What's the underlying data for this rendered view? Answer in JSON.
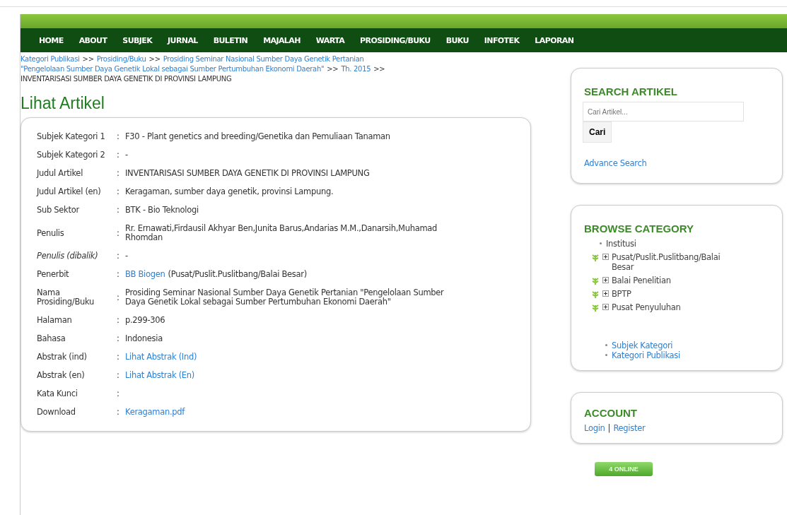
{
  "nav": [
    "HOME",
    "ABOUT",
    "SUBJEK",
    "JURNAL",
    "BULETIN",
    "MAJALAH",
    "WARTA",
    "PROSIDING/BUKU",
    "BUKU",
    "INFOTEK",
    "LAPORAN"
  ],
  "breadcrumb": [
    [
      {
        "kind": "link",
        "text": "Kategori Publikasi"
      },
      {
        "kind": "sep",
        "text": ">>"
      },
      {
        "kind": "link",
        "text": "Prosiding/Buku"
      },
      {
        "kind": "sep",
        "text": ">>"
      },
      {
        "kind": "link",
        "text": "Prosiding Seminar Nasional Sumber Daya Genetik Pertanian"
      }
    ],
    [
      {
        "kind": "link",
        "text": "\"Pengelolaan Sumber Daya Genetik Lokal sebagai Sumber Pertumbuhan Ekonomi Daerah\""
      },
      {
        "kind": "sep",
        "text": ">>"
      },
      {
        "kind": "link",
        "text": "Th. 2015"
      },
      {
        "kind": "sep",
        "text": ">>"
      }
    ],
    [
      {
        "kind": "text",
        "text": "INVENTARISASI SUMBER DAYA GENETIK DI PROVINSI LAMPUNG"
      }
    ]
  ],
  "page_title": "Lihat Artikel",
  "fields": [
    {
      "label": "Subjek Kategori 1",
      "italic": false,
      "colon": ":",
      "value": [
        {
          "kind": "text",
          "text": "F30 - Plant genetics and breeding/Genetika dan Pemuliaan Tanaman"
        }
      ]
    },
    {
      "label": "Subjek Kategori 2",
      "italic": false,
      "colon": ":",
      "value": [
        {
          "kind": "text",
          "text": "-"
        }
      ]
    },
    {
      "label": "Judul Artikel",
      "italic": false,
      "colon": ":",
      "value": [
        {
          "kind": "text",
          "text": "INVENTARISASI SUMBER DAYA GENETIK DI PROVINSI LAMPUNG"
        }
      ]
    },
    {
      "label": "Judul Artikel (en)",
      "italic": false,
      "colon": ":",
      "value": [
        {
          "kind": "text",
          "text": "Keragaman, sumber daya genetik, provinsi Lampung."
        }
      ]
    },
    {
      "label": "Sub Sektor",
      "italic": false,
      "colon": ":",
      "value": [
        {
          "kind": "text",
          "text": "BTK - Bio Teknologi"
        }
      ]
    },
    {
      "label": "Penulis",
      "italic": false,
      "colon": ":",
      "value": [
        {
          "kind": "text",
          "text": "Rr. Ernawati,Firdausil Akhyar Ben,Junita Barus,Andarias M.M.,Danarsih,Muhamad Rhomdan"
        }
      ]
    },
    {
      "label": "Penulis (dibalik)",
      "italic": true,
      "colon": ":",
      "value": [
        {
          "kind": "text",
          "text": "-"
        }
      ]
    },
    {
      "label": "Penerbit",
      "italic": false,
      "colon": ":",
      "value": [
        {
          "kind": "link",
          "text": "BB Biogen"
        },
        {
          "kind": "text",
          "text": "(Pusat/Puslit.Puslitbang/Balai Besar)"
        }
      ]
    },
    {
      "label": "Nama Prosiding/Buku",
      "italic": false,
      "colon": ":",
      "value": [
        {
          "kind": "text",
          "text": "Prosiding Seminar Nasional Sumber Daya Genetik Pertanian \"Pengelolaan Sumber Daya Genetik Lokal sebagai Sumber Pertumbuhan Ekonomi Daerah\""
        }
      ]
    },
    {
      "label": "Halaman",
      "italic": false,
      "colon": ":",
      "value": [
        {
          "kind": "text",
          "text": "p.299-306"
        }
      ]
    },
    {
      "label": "Bahasa",
      "italic": false,
      "colon": ":",
      "value": [
        {
          "kind": "text",
          "text": "Indonesia"
        }
      ]
    },
    {
      "label": "Abstrak (ind)",
      "italic": false,
      "colon": ":",
      "value": [
        {
          "kind": "link",
          "text": "Lihat Abstrak (Ind)"
        }
      ]
    },
    {
      "label": "Abstrak (en)",
      "italic": false,
      "colon": ":",
      "value": [
        {
          "kind": "link",
          "text": "Lihat Abstrak (En)"
        }
      ]
    },
    {
      "label": "Kata Kunci",
      "italic": false,
      "colon": ":"
    },
    {
      "label": "Download",
      "italic": false,
      "colon": ":",
      "value": [
        {
          "kind": "link",
          "text": "Keragaman.pdf"
        }
      ]
    }
  ],
  "search": {
    "title": "SEARCH ARTIKEL",
    "placeholder": "Cari Artikel...",
    "button": "Cari",
    "advanced": "Advance Search"
  },
  "browse": {
    "title": "BROWSE CATEGORY",
    "tree": [
      {
        "label": "Institusi",
        "children": [
          {
            "label": "Pusat/Puslit.Puslitbang/Balai Besar",
            "expanded": false
          },
          {
            "label": "Balai Penelitian",
            "expanded": false
          },
          {
            "label": "BPTP",
            "expanded": false
          },
          {
            "label": "Pusat Penyuluhan",
            "expanded": false
          }
        ]
      }
    ],
    "links": [
      "Subjek Kategori",
      "Kategori Publikasi"
    ]
  },
  "account": {
    "title": "ACCOUNT",
    "links": [
      "Login",
      "Register"
    ],
    "separator": "|"
  },
  "online": "4 ONLINE"
}
